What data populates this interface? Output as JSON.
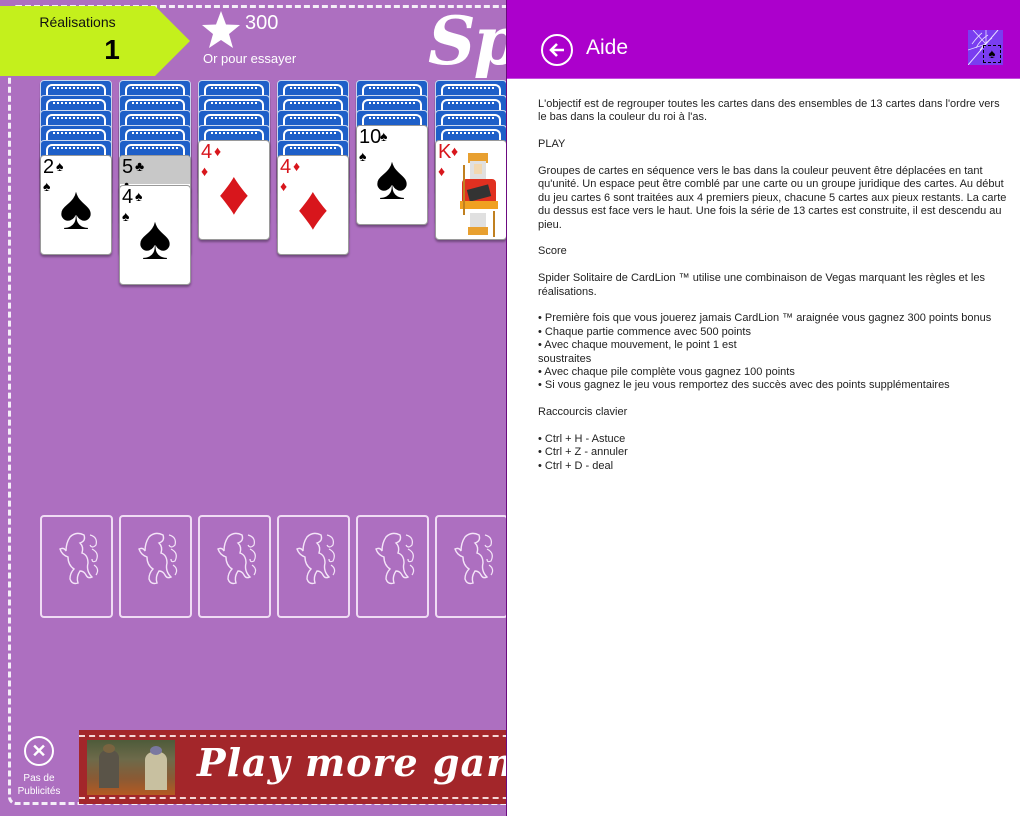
{
  "game": {
    "achievements": {
      "label": "Réalisations",
      "count": "1"
    },
    "gold": {
      "value": "300",
      "label": "Or pour essayer",
      "icon": "star-icon"
    },
    "logo_text": "Spider",
    "tableau": [
      {
        "facedown": 5,
        "faceup": [
          {
            "rank": "2",
            "suit": "♠",
            "color": "black"
          }
        ]
      },
      {
        "facedown": 5,
        "faceup": [
          {
            "rank": "5",
            "suit": "♣",
            "color": "black",
            "partial": true
          },
          {
            "rank": "4",
            "suit": "♠",
            "color": "black"
          }
        ]
      },
      {
        "facedown": 4,
        "faceup": [
          {
            "rank": "4",
            "suit": "♦",
            "color": "red"
          }
        ]
      },
      {
        "facedown": 5,
        "faceup": [
          {
            "rank": "4",
            "suit": "♦",
            "color": "red"
          }
        ]
      },
      {
        "facedown": 3,
        "faceup": [
          {
            "rank": "10",
            "suit": "♠",
            "color": "black"
          }
        ]
      },
      {
        "facedown": 4,
        "faceup": [
          {
            "rank": "K",
            "suit": "♦",
            "color": "red",
            "face": true
          }
        ]
      }
    ],
    "foundation_slots": 6,
    "no_ads": {
      "label_line1": "Pas de",
      "label_line2": "Publicités",
      "icon": "close-icon"
    },
    "ad_banner": {
      "text": "Play more games"
    }
  },
  "help": {
    "title": "Aide",
    "back_icon": "back-arrow-icon",
    "app_icon": "spider-solitaire-app-icon",
    "paragraphs": [
      "L'objectif est de regrouper toutes les cartes dans des ensembles de 13 cartes dans l'ordre vers le bas dans la couleur du roi à l'as.",
      "PLAY",
      "Groupes de cartes en séquence vers le bas dans la couleur peuvent être déplacées en tant qu'unité. Un espace peut être comblé par une carte ou un groupe juridique des cartes. Au début du jeu cartes 6 sont traitées aux 4 premiers pieux, chacune 5 cartes aux pieux restants. La carte du dessus est face vers le haut. Une fois la série de 13 cartes est construite, il est descendu au pieu.",
      "Score",
      "Spider Solitaire de CardLion ™ utilise une combinaison de Vegas marquant les règles et les réalisations."
    ],
    "score_bullets": [
      "• Première fois que vous jouerez jamais CardLion ™ araignée vous gagnez 300 points bonus",
      "• Chaque partie commence avec 500 points",
      "• Avec chaque mouvement, le point 1 est",
      "soustraites",
      "• Avec chaque pile complète vous gagnez 100 points",
      "• Si vous gagnez le jeu vous remportez des succès avec des points supplémentaires"
    ],
    "shortcuts_title": "Raccourcis clavier",
    "shortcuts": [
      "• Ctrl + H - Astuce",
      "• Ctrl + Z - annuler",
      "• Ctrl + D - deal"
    ]
  }
}
